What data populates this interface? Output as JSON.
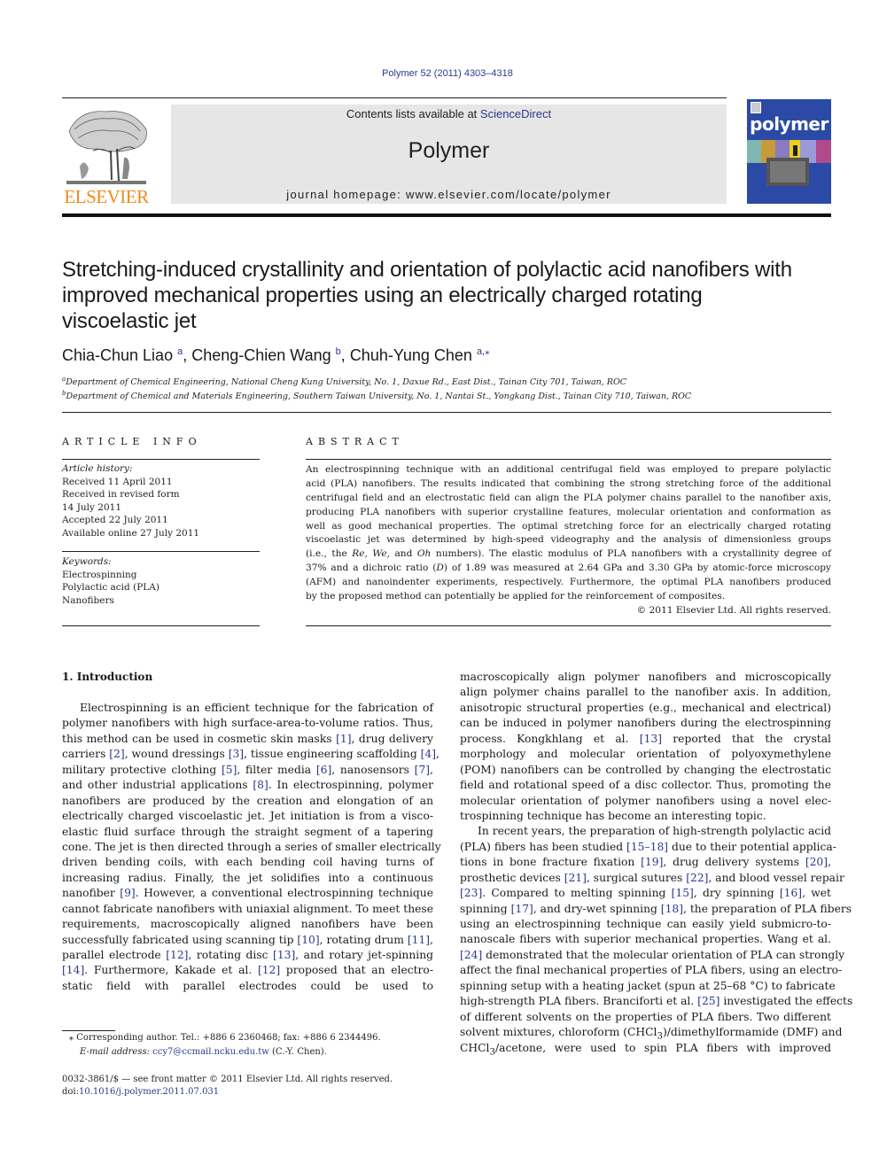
{
  "journal_ref": "Polymer 52 (2011) 4303–4318",
  "masthead": {
    "publisher_logo_text": "ELSEVIER",
    "contents_prefix": "Contents lists available at ",
    "contents_link": "ScienceDirect",
    "journal_name": "Polymer",
    "homepage": "journal homepage: www.elsevier.com/locate/polymer",
    "cover_title": "polymer"
  },
  "colors": {
    "link": "#2a3a8c",
    "elsevier_orange": "#f08a1c",
    "masthead_bg": "#e6e6e6",
    "cover_blue": "#2b4aa6"
  },
  "article": {
    "title": "Stretching-induced crystallinity and orientation of polylactic acid nanofibers with improved mechanical properties using an electrically charged rotating viscoelastic jet",
    "title_lines": [
      "Stretching-induced crystallinity and orientation of polylactic acid nanofibers with",
      "improved mechanical properties using an electrically charged rotating",
      "viscoelastic jet"
    ],
    "authors": [
      {
        "name": "Chia-Chun Liao",
        "marks": "a"
      },
      {
        "name": "Cheng-Chien Wang",
        "marks": "b"
      },
      {
        "name": "Chuh-Yung Chen",
        "marks": "a,⁎"
      }
    ],
    "affiliations": [
      {
        "mark": "a",
        "text": "Department of Chemical Engineering, National Cheng Kung University, No. 1, Daxue Rd., East Dist., Tainan City 701, Taiwan, ROC"
      },
      {
        "mark": "b",
        "text": "Department of Chemical and Materials Engineering, Southern Taiwan University, No. 1, Nantai St., Yongkang Dist., Tainan City 710, Taiwan, ROC"
      }
    ]
  },
  "article_info": {
    "heading": "ARTICLE INFO",
    "history_label": "Article history:",
    "history": [
      "Received 11 April 2011",
      "Received in revised form",
      "14 July 2011",
      "Accepted 22 July 2011",
      "Available online 27 July 2011"
    ],
    "keywords_label": "Keywords:",
    "keywords": [
      "Electrospinning",
      "Polylactic acid (PLA)",
      "Nanofibers"
    ]
  },
  "abstract": {
    "heading": "ABSTRACT",
    "lines": [
      "An electrospinning technique with an additional centrifugal field was employed to prepare polylactic",
      "acid (PLA) nanofibers. The results indicated that combining the strong stretching force of the additional",
      "centrifugal field and an electrostatic field can align the PLA polymer chains parallel to the nanofiber axis,",
      "producing PLA nanofibers with superior crystalline features, molecular orientation and conformation as",
      "well as good mechanical properties. The optimal stretching force for an electrically charged rotating",
      "viscoelastic jet was determined by high-speed videography and the analysis of dimensionless groups",
      "(i.e., the Re, We, and Oh numbers). The elastic modulus of PLA nanofibers with a crystallinity degree of",
      "37% and a dichroic ratio (D) of 1.89 was measured at 2.64 GPa and 3.30 GPa by atomic-force microscopy",
      "(AFM) and nanoindenter experiments, respectively. Furthermore, the optimal PLA nanofibers produced",
      "by the proposed method can potentially be applied for the reinforcement of composites."
    ],
    "copyright": "© 2011 Elsevier Ltd. All rights reserved."
  },
  "section": {
    "heading": "1.  Introduction",
    "left_lines": [
      "Electrospinning is an efficient technique for the fabrication of",
      "polymer nanofibers with high surface-area-to-volume ratios. Thus,",
      "this method can be used in cosmetic skin masks [1], drug delivery",
      "carriers [2], wound dressings [3], tissue engineering scaffolding [4],",
      "military protective clothing [5], filter media [6], nanosensors [7],",
      "and other industrial applications [8]. In electrospinning, polymer",
      "nanofibers are produced by the creation and elongation of an",
      "electrically charged viscoelastic jet. Jet initiation is from a visco-",
      "elastic fluid surface through the straight segment of a tapering",
      "cone. The jet is then directed through a series of smaller electrically",
      "driven bending coils, with each bending coil having turns of",
      "increasing radius. Finally, the jet solidifies into a continuous",
      "nanofiber [9]. However, a conventional electrospinning technique",
      "cannot fabricate nanofibers with uniaxial alignment. To meet these",
      "requirements, macroscopically aligned nanofibers have been",
      "successfully fabricated using scanning tip [10], rotating drum [11],",
      "parallel electrode [12], rotating disc [13], and rotary jet-spinning",
      "[14]. Furthermore, Kakade et al. [12] proposed that an electro-",
      "static field with parallel electrodes could be used to"
    ],
    "right_lines": [
      "macroscopically align polymer nanofibers and microscopically",
      "align polymer chains parallel to the nanofiber axis. In addition,",
      "anisotropic structural properties (e.g., mechanical and electrical)",
      "can be induced in polymer nanofibers during the electrospinning",
      "process. Kongkhlang et al. [13] reported that the crystal",
      "morphology and molecular orientation of polyoxymethylene",
      "(POM) nanofibers can be controlled by changing the electrostatic",
      "field and rotational speed of a disc collector. Thus, promoting the",
      "molecular orientation of polymer nanofibers using a novel elec-",
      "trospinning technique has become an interesting topic.",
      "In recent years, the preparation of high-strength polylactic acid",
      "(PLA) fibers has been studied [15–18] due to their potential applica-",
      "tions in bone fracture fixation [19], drug delivery systems [20],",
      "prosthetic devices [21], surgical sutures [22], and blood vessel repair",
      "[23]. Compared to melting spinning [15], dry spinning [16], wet",
      "spinning [17], and dry-wet spinning [18], the preparation of PLA fibers",
      "using an electrospinning technique can easily yield submicro-to-",
      "nanoscale fibers with superior mechanical properties. Wang et al.",
      "[24] demonstrated that the molecular orientation of PLA can strongly",
      "affect the final mechanical properties of PLA fibers, using an electro-",
      "spinning setup with a heating jacket (spun at 25–68 °C) to fabricate",
      "high-strength PLA fibers. Branciforti et al. [25] investigated the effects",
      "of different solvents on the properties of PLA fibers. Two different",
      "solvent mixtures, chloroform (CHCl3)/dimethylformamide (DMF) and",
      "CHCl3/acetone, were used to spin PLA fibers with improved"
    ]
  },
  "footnotes": {
    "corresponding": "⁎  Corresponding author. Tel.: +886 6 2360468; fax: +886 6 2344496.",
    "email_label": "E-mail address: ",
    "email": "ccy7@ccmail.ncku.edu.tw",
    "email_suffix": " (C.-Y. Chen).",
    "front_matter": "0032-3861/$ — see front matter © 2011 Elsevier Ltd. All rights reserved.",
    "doi_label": "doi:",
    "doi": "10.1016/j.polymer.2011.07.031"
  }
}
